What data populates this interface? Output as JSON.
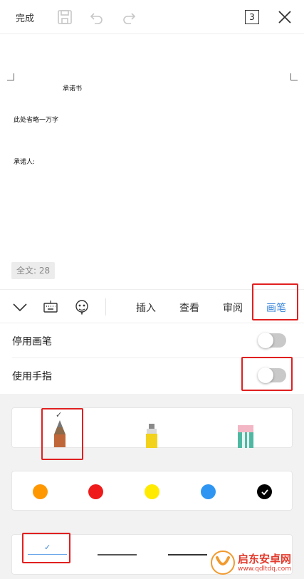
{
  "topbar": {
    "done_label": "完成",
    "page_count": "3",
    "icons": [
      "save-icon",
      "undo-icon",
      "redo-icon",
      "close-icon"
    ]
  },
  "document": {
    "title": "承诺书",
    "body": "此处省略一万字",
    "signer": "承诺人:",
    "word_count": "全文: 28"
  },
  "toolbar": {
    "icons": [
      "collapse-chevron-icon",
      "keyboard-icon",
      "emoji-icon"
    ],
    "tabs": [
      {
        "label": "插入",
        "active": false
      },
      {
        "label": "查看",
        "active": false
      },
      {
        "label": "审阅",
        "active": false
      },
      {
        "label": "画笔",
        "active": true
      }
    ]
  },
  "settings": [
    {
      "label": "停用画笔",
      "enabled": false
    },
    {
      "label": "使用手指",
      "enabled": false
    }
  ],
  "pens": [
    {
      "name": "pencil",
      "selected": true
    },
    {
      "name": "highlighter",
      "selected": false
    },
    {
      "name": "eraser",
      "selected": false
    }
  ],
  "colors": [
    {
      "hex": "#ff9800",
      "selected": false
    },
    {
      "hex": "#ef1b1b",
      "selected": false
    },
    {
      "hex": "#ffea00",
      "selected": false
    },
    {
      "hex": "#2e96f2",
      "selected": false
    },
    {
      "hex": "#000000",
      "selected": true
    }
  ],
  "line_widths": [
    {
      "color": "#6aa6ea",
      "selected": true
    },
    {
      "color": "#555555",
      "selected": false
    },
    {
      "color": "#333333",
      "selected": false
    }
  ],
  "watermark": {
    "title": "启东安卓网",
    "url": "www.qdltdq.com"
  }
}
